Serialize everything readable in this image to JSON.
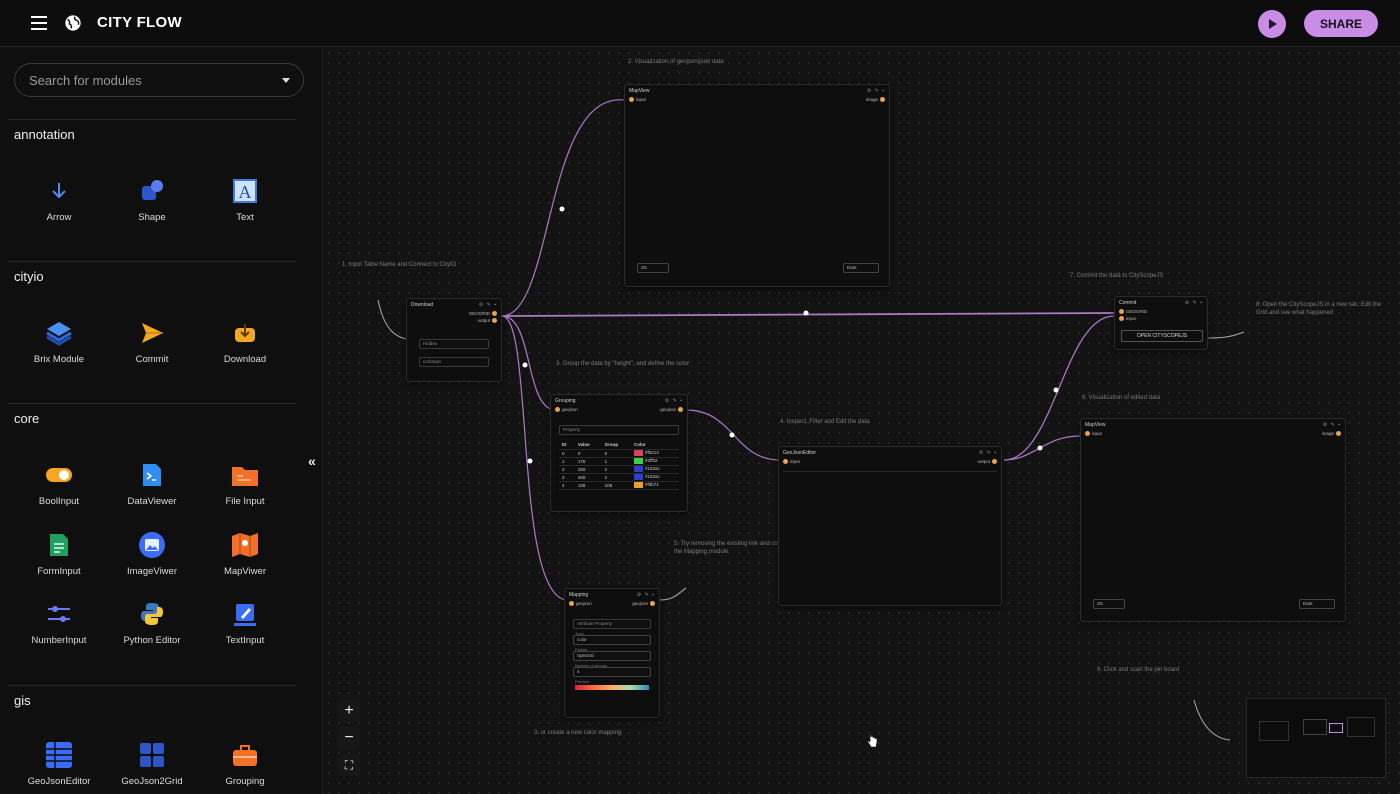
{
  "header": {
    "title": "CITY FLOW",
    "share_label": "SHARE"
  },
  "search": {
    "placeholder": "Search for modules"
  },
  "sidebar": {
    "sections": [
      {
        "title": "annotation",
        "items": [
          "Arrow",
          "Shape",
          "Text"
        ]
      },
      {
        "title": "cityio",
        "items": [
          "Brix Module",
          "Commit",
          "Download"
        ]
      },
      {
        "title": "core",
        "items": [
          "BoolInput",
          "DataViewer",
          "File Input",
          "FormInput",
          "ImageViwer",
          "MapViwer",
          "NumberInput",
          "Python Editor",
          "TextInput"
        ]
      },
      {
        "title": "gis",
        "items": [
          "GeoJsonEditor",
          "GeoJson2Grid",
          "Grouping"
        ]
      }
    ]
  },
  "canvas": {
    "notes": [
      "2. Visualization of geojson/json data",
      "1. Input Table Name and Connect to CityIO",
      "3. Group the data by \"height\", and define the color",
      "4. Inspect, Filter and Edit the data",
      "7. Commit the data to CityScopeJS",
      "8. Open the CityScopeJS in a new tab, Edit the Grid and see what happened",
      "6. Visualization of edited data",
      "5. Try removing the existing link and connect with the Mapping module",
      "3. or create a new color mapping",
      "9. Click and scan the pin board"
    ],
    "nodes": {
      "mapview_top": {
        "title": "MapView",
        "port_in": "input",
        "port_out": "image",
        "sel1": "2D",
        "sel2": "Dark"
      },
      "download": {
        "title": "Download",
        "port_out1": "GEOGRID",
        "port_out2": "output",
        "field1": "Hidden",
        "field2_label": "Table name",
        "field2": "corktown"
      },
      "grouping": {
        "title": "Grouping",
        "port_in": "geojson",
        "port_out": "geojson",
        "field": "Property",
        "headers": [
          "ID",
          "Value",
          "Group",
          "Color"
        ],
        "rows": [
          [
            "0",
            "0",
            "0",
            "#f5213",
            "#e0405a"
          ],
          [
            "1",
            "176",
            "1",
            "#2ff52",
            "#3ccf4a"
          ],
          [
            "2",
            "250",
            "2",
            "#152ac",
            "#2a3fd0"
          ],
          [
            "3",
            "460",
            "2",
            "#152ac",
            "#2a3fd0"
          ],
          [
            "4",
            "108",
            "108",
            "#f5b71",
            "#e8a030"
          ]
        ]
      },
      "geojson_editor": {
        "title": "GeoJsonEditor",
        "port_in": "input",
        "port_out": "output"
      },
      "commit": {
        "title": "Commit",
        "port_in1": "GEOGRID",
        "port_in2": "input",
        "button": "OPEN CITYSCOPEJS"
      },
      "mapview_right": {
        "title": "MapView",
        "port_in": "input",
        "port_out": "image",
        "sel1": "2D",
        "sel2": "Dark"
      },
      "mapping": {
        "title": "Mapping",
        "port_in": "geojson",
        "port_out": "geojson",
        "field1": "Attribute Property",
        "f2_label": "Type",
        "f2": "color",
        "f3_label": "Palette",
        "f3": "Spectral",
        "f4_label": "Number of groups",
        "f4": "4",
        "f5_label": "Preview"
      }
    }
  },
  "colors": {
    "accent": "#c98de6",
    "port": "#e8a34b",
    "wire": "#c98de6"
  },
  "icons": {
    "play": "play-icon",
    "menu": "menu-icon",
    "globe": "globe-icon"
  }
}
